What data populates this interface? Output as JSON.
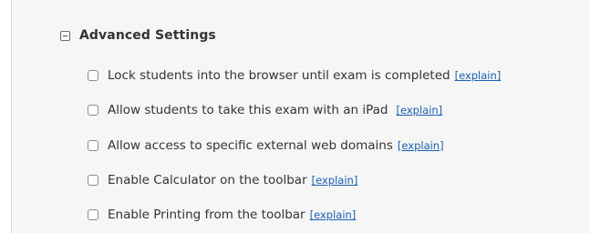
{
  "section": {
    "title": "Advanced Settings",
    "collapse_icon": "minus-box-icon"
  },
  "options": [
    {
      "label": "Lock students into the browser until exam is completed",
      "explain": "[explain]",
      "checked": false
    },
    {
      "label": "Allow students to take this exam with an iPad",
      "explain": "[explain]",
      "checked": false
    },
    {
      "label": "Allow access to specific external web domains",
      "explain": "[explain]",
      "checked": false
    },
    {
      "label": "Enable Calculator on the toolbar",
      "explain": "[explain]",
      "checked": false
    },
    {
      "label": "Enable Printing from the toolbar",
      "explain": "[explain]",
      "checked": false
    }
  ],
  "colors": {
    "panel_background": "#f6f6f6",
    "text": "#333333",
    "link": "#1a5fb4"
  }
}
